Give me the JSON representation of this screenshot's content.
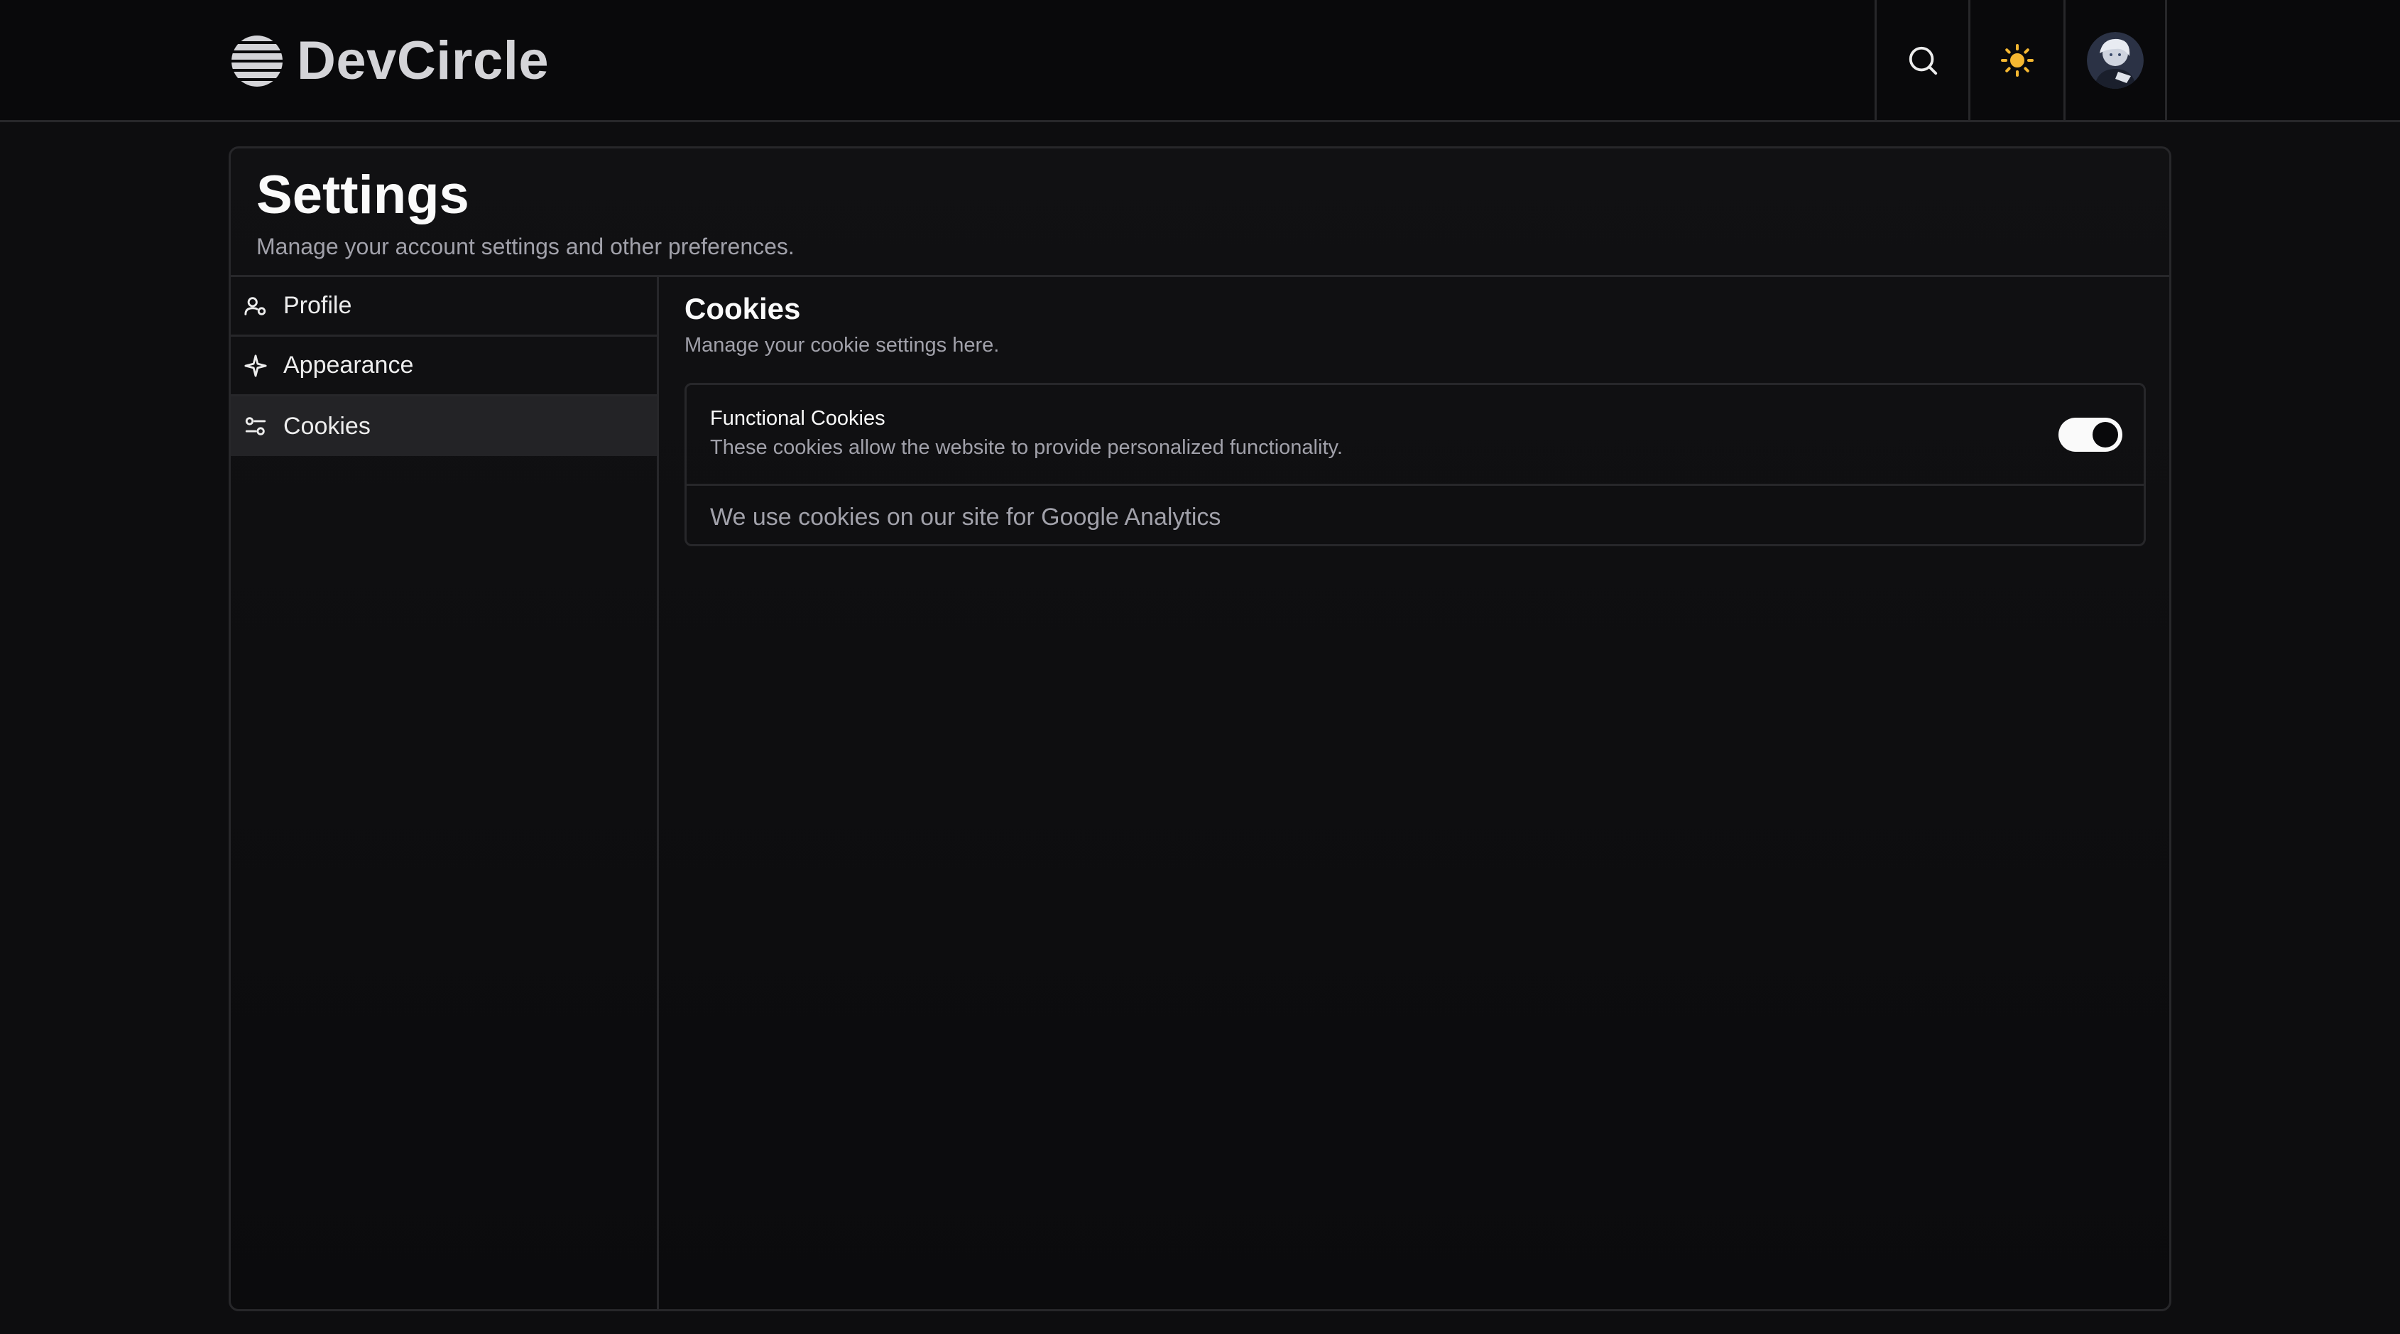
{
  "header": {
    "brand_name": "DevCircle",
    "icons": {
      "logo": "striped-globe-icon",
      "search": "search-icon",
      "theme": "sun-icon",
      "avatar": "user-avatar"
    },
    "theme_icon_color": "#f5b731"
  },
  "settings": {
    "title": "Settings",
    "subtitle": "Manage your account settings and other preferences."
  },
  "sidebar": {
    "items": [
      {
        "label": "Profile",
        "icon": "user-icon",
        "active": false
      },
      {
        "label": "Appearance",
        "icon": "sparkle-icon",
        "active": false
      },
      {
        "label": "Cookies",
        "icon": "sliders-icon",
        "active": true
      }
    ]
  },
  "cookies": {
    "title": "Cookies",
    "description": "Manage your cookie settings here.",
    "functional": {
      "title": "Functional Cookies",
      "description": "These cookies allow the website to provide personalized functionality.",
      "enabled": true
    },
    "note": "We use cookies on our site for Google Analytics"
  }
}
